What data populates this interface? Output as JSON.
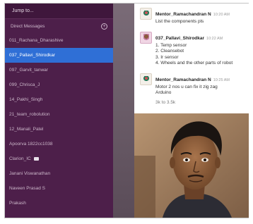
{
  "sidebar": {
    "jump_label": "Jump to...",
    "dm_header": "Direct Messages",
    "items": [
      {
        "label": "011_Rachana_Dharashive",
        "active": false
      },
      {
        "label": "037_Pallavi_Shirodkar",
        "active": true
      },
      {
        "label": "097_Garvit_tanwar",
        "active": false
      },
      {
        "label": "099_Chrisca_J",
        "active": false
      },
      {
        "label": "14_Pakhi_Singh",
        "active": false
      },
      {
        "label": "21_team_robolution",
        "active": false
      },
      {
        "label": "12_Manali_Patel",
        "active": false
      },
      {
        "label": "Apoorva 1822cc1038",
        "active": false
      },
      {
        "label": "Clarion_IC",
        "active": false,
        "icon": "chat-icon"
      },
      {
        "label": "Janani Viswanathan",
        "active": false
      },
      {
        "label": "Naveen Prasad S",
        "active": false
      },
      {
        "label": "Prakash",
        "active": false
      }
    ]
  },
  "chat": {
    "messages": [
      {
        "sender": "Mentor_Ramachandran N",
        "time": "10:20 AM",
        "lines": [
          "List the components pls"
        ]
      },
      {
        "sender": "037_Pallavi_Shirodkar",
        "time": "10:22 AM",
        "lines": [
          "1. Temp sensor",
          "2. Cleansebot",
          "3. Ir sensor",
          "4. Wheels and the other parts of robot"
        ]
      },
      {
        "sender": "Mentor_Ramachandran N",
        "time": "10:25 AM",
        "lines": [
          "Motor 2 nos u can fix it zig zag",
          "Arduino"
        ]
      },
      {
        "sender": "",
        "time": "",
        "lines": [
          "3k to 3.5k"
        ]
      }
    ]
  },
  "colors": {
    "sidebar_bg": "#4d1f4a",
    "active_item": "#2f6fd6"
  }
}
